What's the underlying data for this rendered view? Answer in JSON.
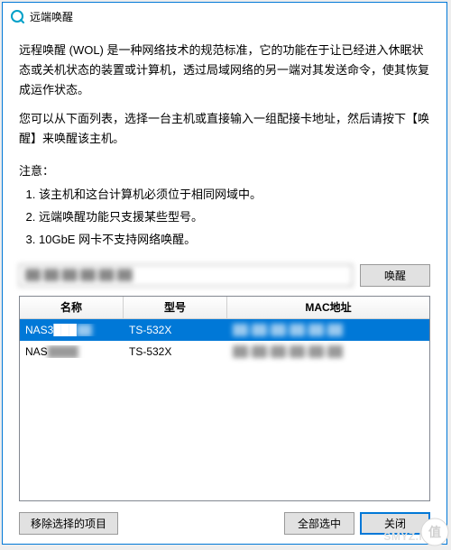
{
  "window": {
    "title": "远端唤醒"
  },
  "content": {
    "para1": "远程唤醒 (WOL) 是一种网络技术的规范标准，它的功能在于让已经进入休眠状态或关机状态的装置或计算机，透过局域网络的另一端对其发送命令，使其恢复成运作状态。",
    "para2": "您可以从下面列表，选择一台主机或直接输入一组配接卡地址，然后请按下【唤醒】来唤醒该主机。",
    "notes_label": "注意：",
    "notes": [
      "该主机和这台计算机必须位于相同网域中。",
      "远端唤醒功能只支援某些型号。",
      "10GbE 网卡不支持网络唤醒。"
    ]
  },
  "input": {
    "mac_value": "██ ██ ██ ██ ██ ██",
    "wake_label": "唤醒"
  },
  "table": {
    "headers": {
      "name": "名称",
      "model": "型号",
      "mac": "MAC地址"
    },
    "rows": [
      {
        "name": "NAS3███",
        "model": "TS-532X",
        "mac": "██-██-██-██-██-██",
        "selected": true
      },
      {
        "name": "NAS████",
        "model": "TS-532X",
        "mac": "██-██-██-██-██-██",
        "selected": false
      }
    ]
  },
  "footer": {
    "remove_label": "移除选择的项目",
    "select_all_label": "全部选中",
    "close_label": "关闭"
  },
  "watermark": "SMYZ.NET"
}
